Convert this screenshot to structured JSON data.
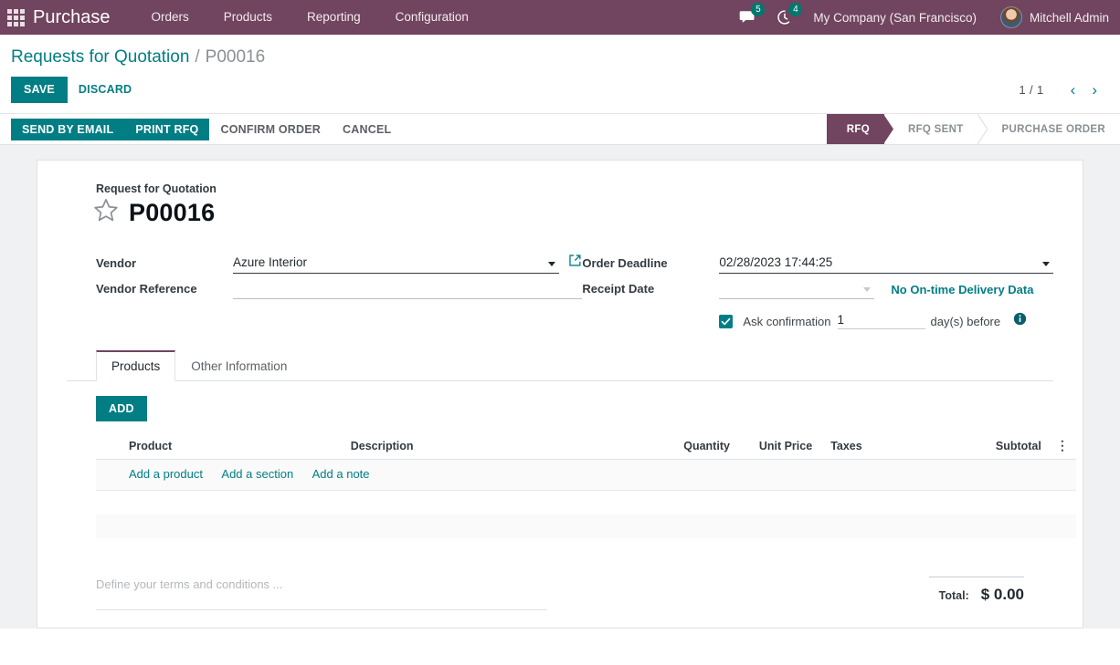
{
  "navbar": {
    "apps_icon": "apps-grid-icon",
    "brand": "Purchase",
    "menu": [
      {
        "label": "Orders"
      },
      {
        "label": "Products"
      },
      {
        "label": "Reporting"
      },
      {
        "label": "Configuration"
      }
    ],
    "messages": {
      "icon": "messages-icon",
      "count": "5"
    },
    "activities": {
      "icon": "activity-clock-icon",
      "count": "4"
    },
    "company": "My Company (San Francisco)",
    "user": "Mitchell Admin"
  },
  "breadcrumb": {
    "parent": "Requests for Quotation",
    "separator": "/",
    "current": "P00016"
  },
  "control": {
    "save_label": "SAVE",
    "discard_label": "DISCARD",
    "pager_value": "1 / 1",
    "prev_icon": "chevron-left-icon",
    "next_icon": "chevron-right-icon"
  },
  "statusbar": {
    "buttons": [
      {
        "label": "SEND BY EMAIL",
        "style": "filled"
      },
      {
        "label": "PRINT RFQ",
        "style": "filled"
      },
      {
        "label": "CONFIRM ORDER",
        "style": "plain"
      },
      {
        "label": "CANCEL",
        "style": "plain"
      }
    ],
    "stages": [
      {
        "label": "RFQ",
        "active": true
      },
      {
        "label": "RFQ SENT",
        "active": false
      },
      {
        "label": "PURCHASE ORDER",
        "active": false
      }
    ]
  },
  "form": {
    "subtitle": "Request for Quotation",
    "star_icon": "star-outline-icon",
    "record_name": "P00016",
    "vendor": {
      "label": "Vendor",
      "value": "Azure Interior",
      "placeholder": "",
      "dropdown_icon": "chevron-down-icon",
      "external_link_icon": "external-link-icon"
    },
    "vendor_reference": {
      "label": "Vendor Reference",
      "value": "",
      "placeholder": ""
    },
    "order_deadline": {
      "label": "Order Deadline",
      "value": "02/28/2023 17:44:25",
      "dropdown_icon": "chevron-down-icon"
    },
    "receipt_date": {
      "label": "Receipt Date",
      "value": "",
      "dropdown_icon": "chevron-down-icon"
    },
    "delivery_note": "No On-time Delivery Data",
    "ask_confirmation": {
      "checked": true,
      "check_icon": "checkmark-icon",
      "label": "Ask confirmation",
      "days_value": "1",
      "suffix": "day(s) before",
      "info_icon": "info-circle-icon"
    }
  },
  "notebook": {
    "tabs": [
      {
        "label": "Products",
        "active": true
      },
      {
        "label": "Other Information",
        "active": false
      }
    ],
    "add_button": "ADD",
    "columns": [
      {
        "label": "Product"
      },
      {
        "label": "Description"
      },
      {
        "label": "Quantity"
      },
      {
        "label": "Unit Price"
      },
      {
        "label": "Taxes"
      },
      {
        "label": "Subtotal"
      }
    ],
    "optional_columns_icon": "vertical-dots-icon",
    "add_links": [
      {
        "label": "Add a product"
      },
      {
        "label": "Add a section"
      },
      {
        "label": "Add a note"
      }
    ]
  },
  "footer": {
    "terms_placeholder": "Define your terms and conditions ...",
    "total_label": "Total:",
    "total_value": "$ 0.00"
  },
  "colors": {
    "navbar": "#71445f",
    "accent": "#017e84",
    "stage_active": "#71445f",
    "content_bg": "#f0f1f3"
  }
}
